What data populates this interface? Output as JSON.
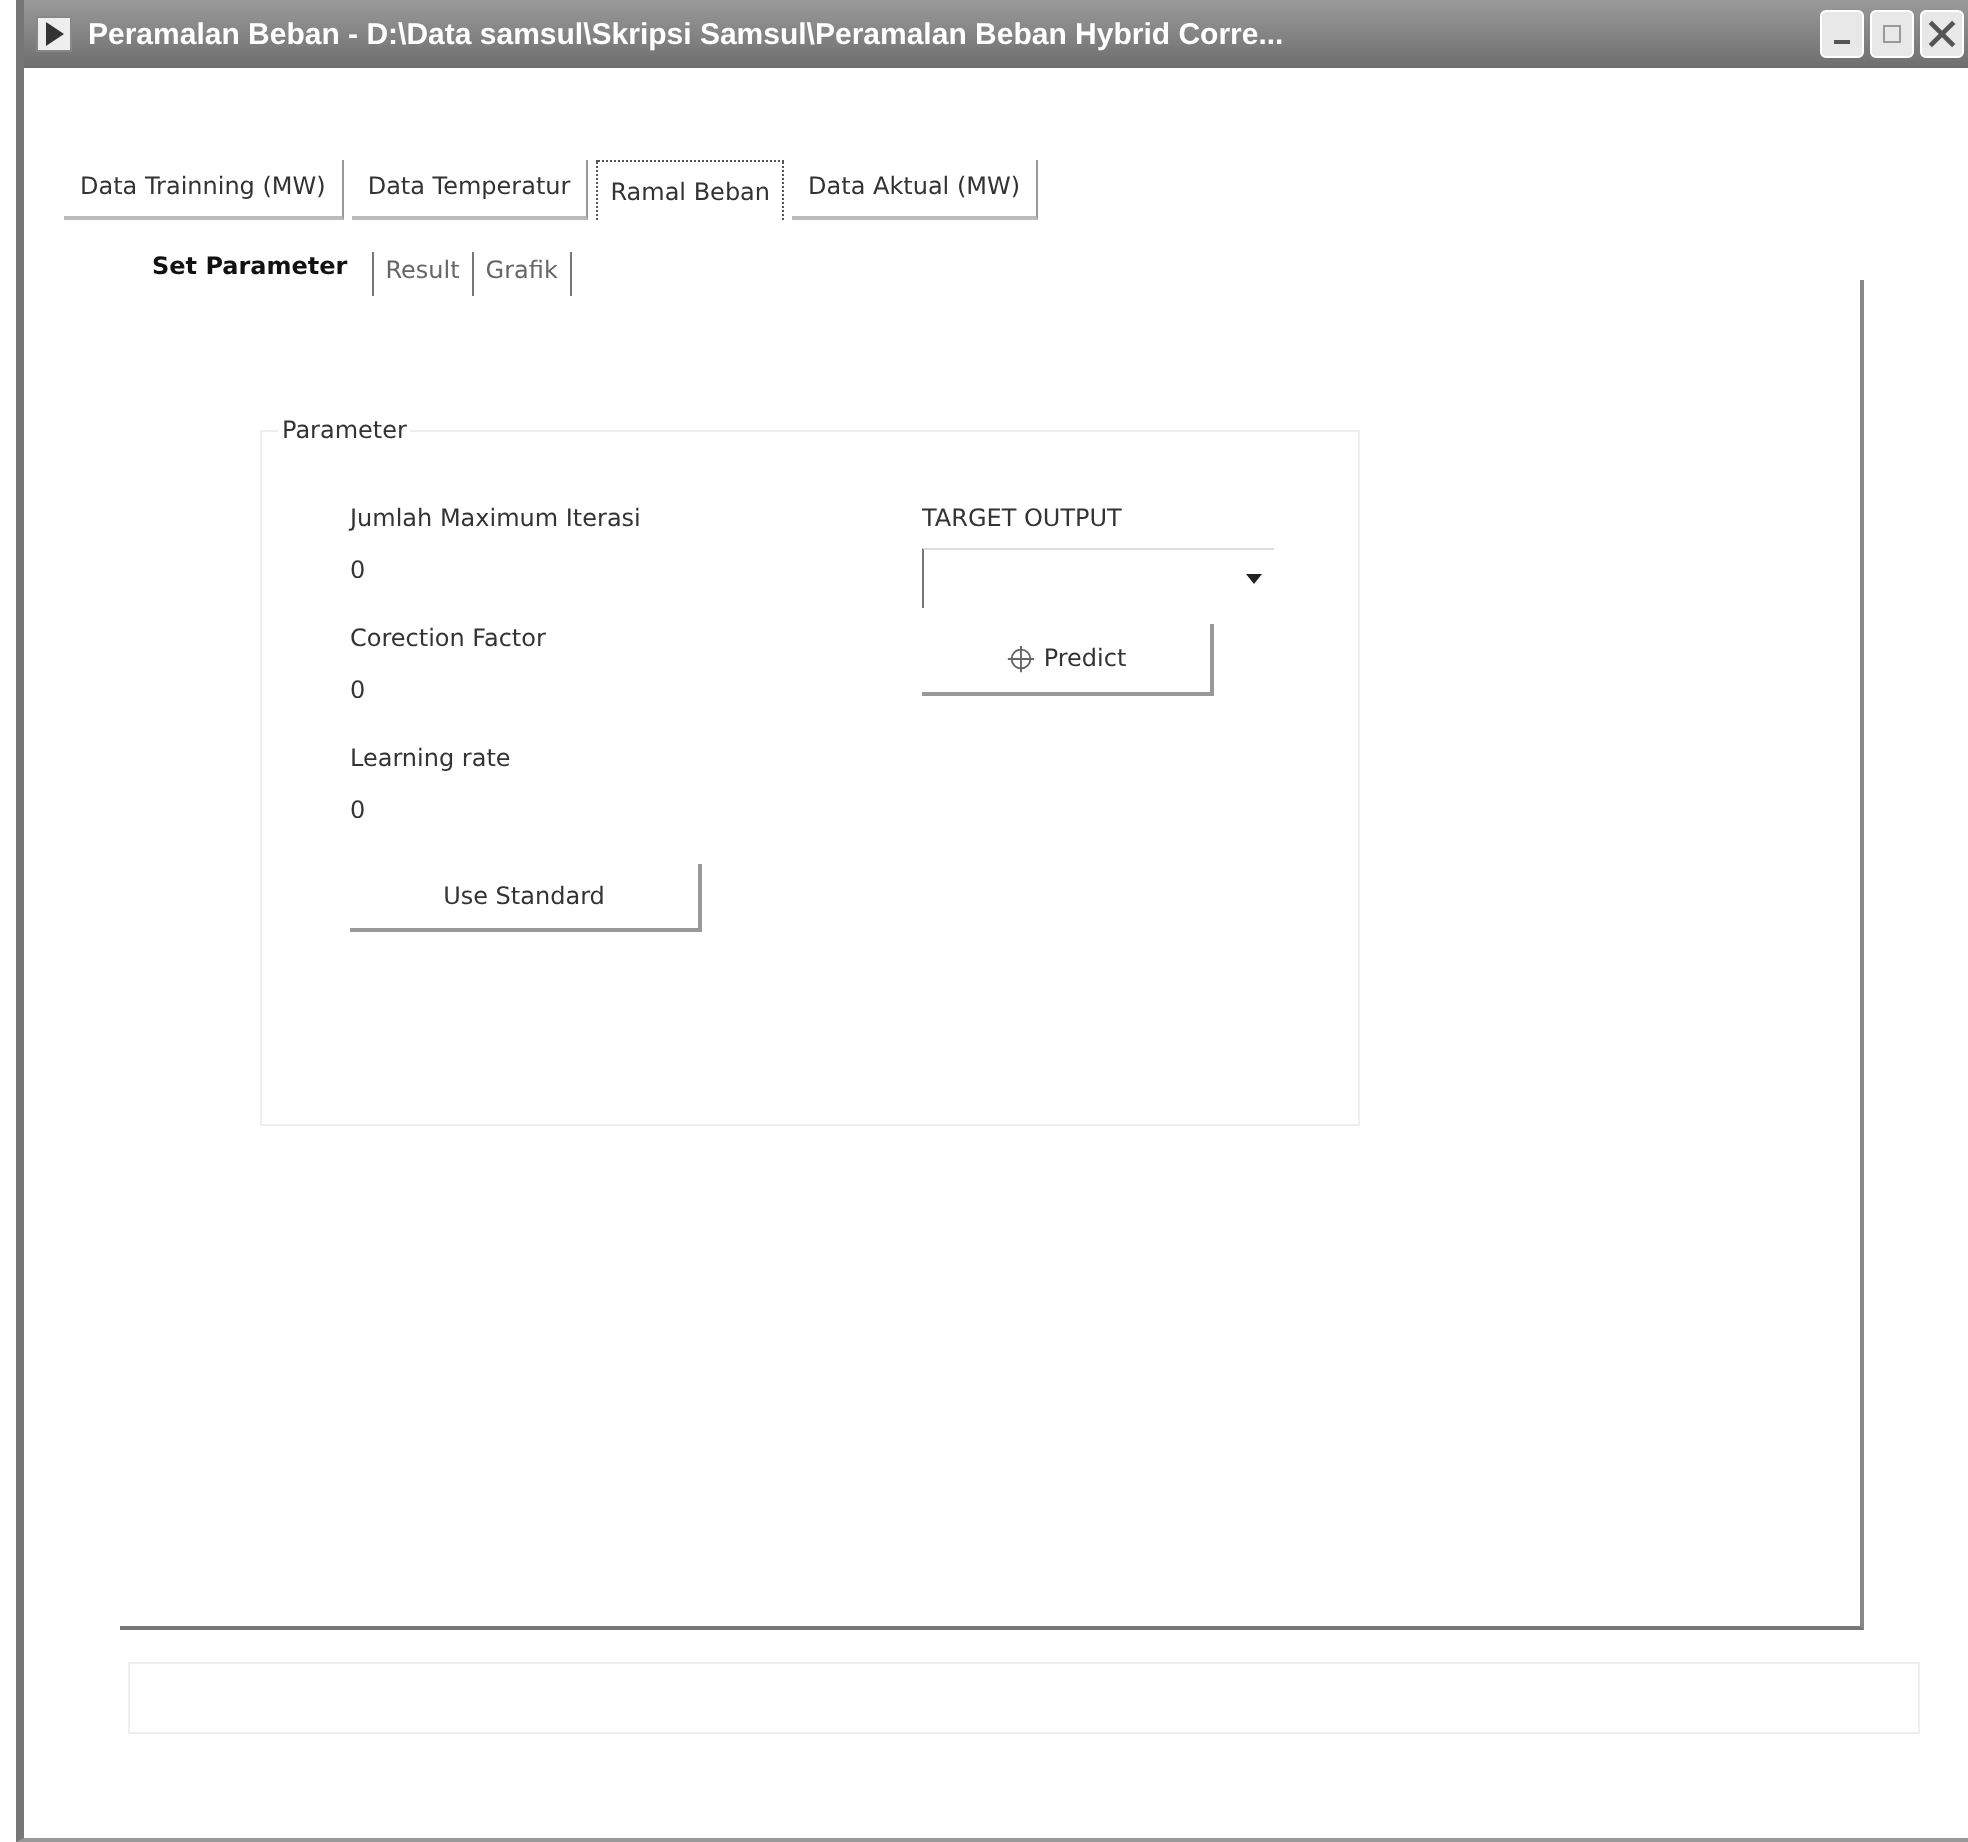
{
  "window": {
    "title": "Peramalan Beban - D:\\Data samsul\\Skripsi Samsul\\Peramalan Beban Hybrid Corre..."
  },
  "tabs": [
    {
      "label": "Data Trainning (MW)",
      "selected": false
    },
    {
      "label": "Data Temperatur",
      "selected": false
    },
    {
      "label": "Ramal Beban",
      "selected": true
    },
    {
      "label": "Data Aktual (MW)",
      "selected": false
    }
  ],
  "subtabs": [
    {
      "label": "Set Parameter",
      "selected": true
    },
    {
      "label": "Result",
      "selected": false
    },
    {
      "label": "Grafik",
      "selected": false
    }
  ],
  "parameter_group": {
    "title": "Parameter",
    "fields": [
      {
        "label": "Jumlah Maximum Iterasi",
        "value": "0"
      },
      {
        "label": "Corection Factor",
        "value": "0"
      },
      {
        "label": "Learning rate",
        "value": "0"
      }
    ],
    "use_standard_button": "Use Standard",
    "target_output": {
      "label": "TARGET OUTPUT"
    },
    "predict_button": "Predict"
  }
}
